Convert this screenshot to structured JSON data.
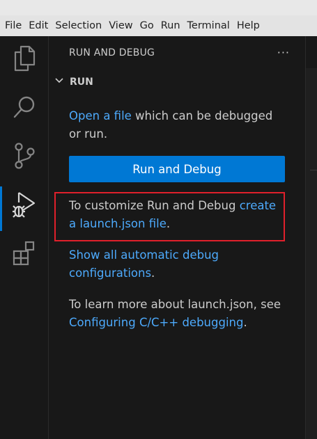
{
  "menu": [
    "File",
    "Edit",
    "Selection",
    "View",
    "Go",
    "Run",
    "Terminal",
    "Help"
  ],
  "activity_bar": {
    "items": [
      {
        "name": "explorer-icon"
      },
      {
        "name": "search-icon"
      },
      {
        "name": "source-control-icon"
      },
      {
        "name": "run-and-debug-icon",
        "active": true
      },
      {
        "name": "extensions-icon"
      }
    ]
  },
  "sidebar": {
    "title": "RUN AND DEBUG",
    "more_icon": "···",
    "section": {
      "title": "RUN",
      "chevron": "chevron-down-icon"
    },
    "open_file": {
      "link": "Open a file",
      "text": " which can be debugged or run."
    },
    "run_button": "Run and Debug",
    "customize": {
      "text": "To customize Run and Debug ",
      "link": "create a launch.json file",
      "suffix": "."
    },
    "show_all": {
      "link": "Show all automatic debug configurations",
      "suffix": "."
    },
    "learn_more": {
      "text": "To learn more about launch.json, see ",
      "link": "Configuring C/C++ debugging",
      "suffix": "."
    }
  },
  "colors": {
    "accent": "#0078d4",
    "link": "#4daafc",
    "highlight": "#e0202b",
    "background": "#181818"
  }
}
